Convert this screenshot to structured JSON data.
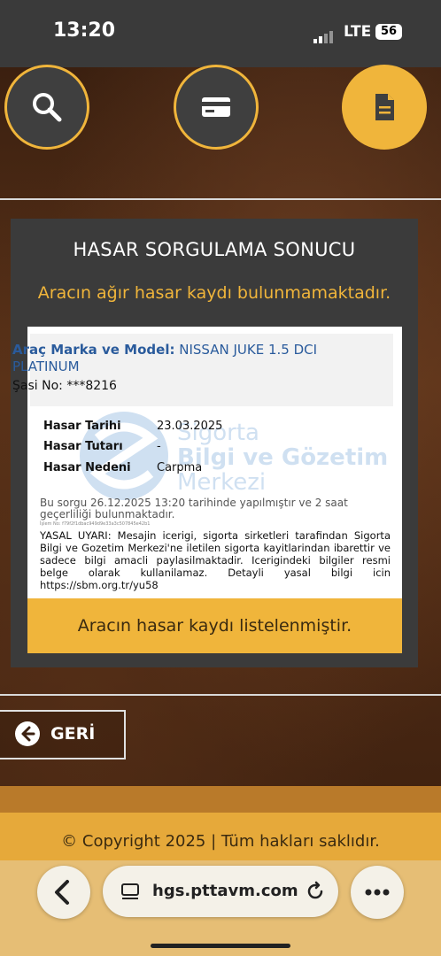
{
  "status_bar": {
    "time": "13:20",
    "network": "LTE",
    "battery": "56"
  },
  "nav_icons": [
    {
      "name": "search-icon",
      "active": false
    },
    {
      "name": "card-icon",
      "active": false
    },
    {
      "name": "document-icon",
      "active": true
    }
  ],
  "result": {
    "title": "HASAR SORGULAMA SONUCU",
    "subtitle": "Aracın ağır hasar kaydı bulunmamaktadır.",
    "brand_label": "Araç Marka ve Model:",
    "brand_value": "NISSAN JUKE 1.5 DCI PLATINUM",
    "chassis_label": "Şasi No:",
    "chassis_value": "***8216",
    "rows": [
      {
        "label": "Hasar Tarihi",
        "value": "23.03.2025"
      },
      {
        "label": "Hasar Tutarı",
        "value": "-"
      },
      {
        "label": "Hasar Nedeni",
        "value": "Carpma"
      }
    ],
    "watermark": [
      "Sigorta",
      "Bilgi ve Gözetim",
      "Merkezi"
    ],
    "query_note": "Bu sorgu 26.12.2025 13:20 tarihinde yapılmıştır ve 2 saat geçerliliği bulunmaktadır.",
    "query_id": "İşlem No: f79f2f1dbac949d9e33a3c507845e42b1",
    "warning": "YASAL UYARI: Mesajin icerigi, sigorta sirketleri tarafindan Sigorta Bilgi ve Gozetim Merkezi'ne iletilen sigorta kayitlarindan ibarettir ve sadece bilgi amacli paylasilmaktadir. Icerigindeki bilgiler resmi belge olarak kullanilamaz. Detayli yasal bilgi icin https://sbm.org.tr/yu58",
    "banner": "Aracın hasar kaydı listelenmiştir."
  },
  "back_button": {
    "label": "GERİ"
  },
  "footer": {
    "copyright": "© Copyright 2025 | Tüm hakları saklıdır."
  },
  "browser": {
    "url": "hgs.pttavm.com"
  },
  "colors": {
    "accent": "#f0b53b",
    "panel": "#3b3b3b",
    "link_blue": "#2a5b9c"
  }
}
